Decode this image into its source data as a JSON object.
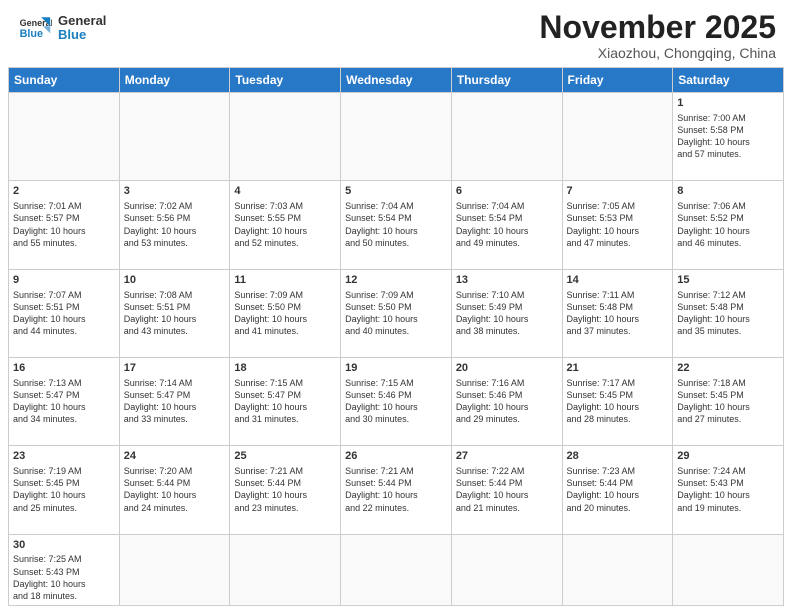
{
  "header": {
    "logo_line1": "General",
    "logo_line2": "Blue",
    "title": "November 2025",
    "subtitle": "Xiaozhou, Chongqing, China"
  },
  "weekdays": [
    "Sunday",
    "Monday",
    "Tuesday",
    "Wednesday",
    "Thursday",
    "Friday",
    "Saturday"
  ],
  "weeks": [
    [
      {
        "day": "",
        "info": ""
      },
      {
        "day": "",
        "info": ""
      },
      {
        "day": "",
        "info": ""
      },
      {
        "day": "",
        "info": ""
      },
      {
        "day": "",
        "info": ""
      },
      {
        "day": "",
        "info": ""
      },
      {
        "day": "1",
        "info": "Sunrise: 7:00 AM\nSunset: 5:58 PM\nDaylight: 10 hours\nand 57 minutes."
      }
    ],
    [
      {
        "day": "2",
        "info": "Sunrise: 7:01 AM\nSunset: 5:57 PM\nDaylight: 10 hours\nand 55 minutes."
      },
      {
        "day": "3",
        "info": "Sunrise: 7:02 AM\nSunset: 5:56 PM\nDaylight: 10 hours\nand 53 minutes."
      },
      {
        "day": "4",
        "info": "Sunrise: 7:03 AM\nSunset: 5:55 PM\nDaylight: 10 hours\nand 52 minutes."
      },
      {
        "day": "5",
        "info": "Sunrise: 7:04 AM\nSunset: 5:54 PM\nDaylight: 10 hours\nand 50 minutes."
      },
      {
        "day": "6",
        "info": "Sunrise: 7:04 AM\nSunset: 5:54 PM\nDaylight: 10 hours\nand 49 minutes."
      },
      {
        "day": "7",
        "info": "Sunrise: 7:05 AM\nSunset: 5:53 PM\nDaylight: 10 hours\nand 47 minutes."
      },
      {
        "day": "8",
        "info": "Sunrise: 7:06 AM\nSunset: 5:52 PM\nDaylight: 10 hours\nand 46 minutes."
      }
    ],
    [
      {
        "day": "9",
        "info": "Sunrise: 7:07 AM\nSunset: 5:51 PM\nDaylight: 10 hours\nand 44 minutes."
      },
      {
        "day": "10",
        "info": "Sunrise: 7:08 AM\nSunset: 5:51 PM\nDaylight: 10 hours\nand 43 minutes."
      },
      {
        "day": "11",
        "info": "Sunrise: 7:09 AM\nSunset: 5:50 PM\nDaylight: 10 hours\nand 41 minutes."
      },
      {
        "day": "12",
        "info": "Sunrise: 7:09 AM\nSunset: 5:50 PM\nDaylight: 10 hours\nand 40 minutes."
      },
      {
        "day": "13",
        "info": "Sunrise: 7:10 AM\nSunset: 5:49 PM\nDaylight: 10 hours\nand 38 minutes."
      },
      {
        "day": "14",
        "info": "Sunrise: 7:11 AM\nSunset: 5:48 PM\nDaylight: 10 hours\nand 37 minutes."
      },
      {
        "day": "15",
        "info": "Sunrise: 7:12 AM\nSunset: 5:48 PM\nDaylight: 10 hours\nand 35 minutes."
      }
    ],
    [
      {
        "day": "16",
        "info": "Sunrise: 7:13 AM\nSunset: 5:47 PM\nDaylight: 10 hours\nand 34 minutes."
      },
      {
        "day": "17",
        "info": "Sunrise: 7:14 AM\nSunset: 5:47 PM\nDaylight: 10 hours\nand 33 minutes."
      },
      {
        "day": "18",
        "info": "Sunrise: 7:15 AM\nSunset: 5:47 PM\nDaylight: 10 hours\nand 31 minutes."
      },
      {
        "day": "19",
        "info": "Sunrise: 7:15 AM\nSunset: 5:46 PM\nDaylight: 10 hours\nand 30 minutes."
      },
      {
        "day": "20",
        "info": "Sunrise: 7:16 AM\nSunset: 5:46 PM\nDaylight: 10 hours\nand 29 minutes."
      },
      {
        "day": "21",
        "info": "Sunrise: 7:17 AM\nSunset: 5:45 PM\nDaylight: 10 hours\nand 28 minutes."
      },
      {
        "day": "22",
        "info": "Sunrise: 7:18 AM\nSunset: 5:45 PM\nDaylight: 10 hours\nand 27 minutes."
      }
    ],
    [
      {
        "day": "23",
        "info": "Sunrise: 7:19 AM\nSunset: 5:45 PM\nDaylight: 10 hours\nand 25 minutes."
      },
      {
        "day": "24",
        "info": "Sunrise: 7:20 AM\nSunset: 5:44 PM\nDaylight: 10 hours\nand 24 minutes."
      },
      {
        "day": "25",
        "info": "Sunrise: 7:21 AM\nSunset: 5:44 PM\nDaylight: 10 hours\nand 23 minutes."
      },
      {
        "day": "26",
        "info": "Sunrise: 7:21 AM\nSunset: 5:44 PM\nDaylight: 10 hours\nand 22 minutes."
      },
      {
        "day": "27",
        "info": "Sunrise: 7:22 AM\nSunset: 5:44 PM\nDaylight: 10 hours\nand 21 minutes."
      },
      {
        "day": "28",
        "info": "Sunrise: 7:23 AM\nSunset: 5:44 PM\nDaylight: 10 hours\nand 20 minutes."
      },
      {
        "day": "29",
        "info": "Sunrise: 7:24 AM\nSunset: 5:43 PM\nDaylight: 10 hours\nand 19 minutes."
      }
    ],
    [
      {
        "day": "30",
        "info": "Sunrise: 7:25 AM\nSunset: 5:43 PM\nDaylight: 10 hours\nand 18 minutes."
      },
      {
        "day": "",
        "info": ""
      },
      {
        "day": "",
        "info": ""
      },
      {
        "day": "",
        "info": ""
      },
      {
        "day": "",
        "info": ""
      },
      {
        "day": "",
        "info": ""
      },
      {
        "day": "",
        "info": ""
      }
    ]
  ]
}
